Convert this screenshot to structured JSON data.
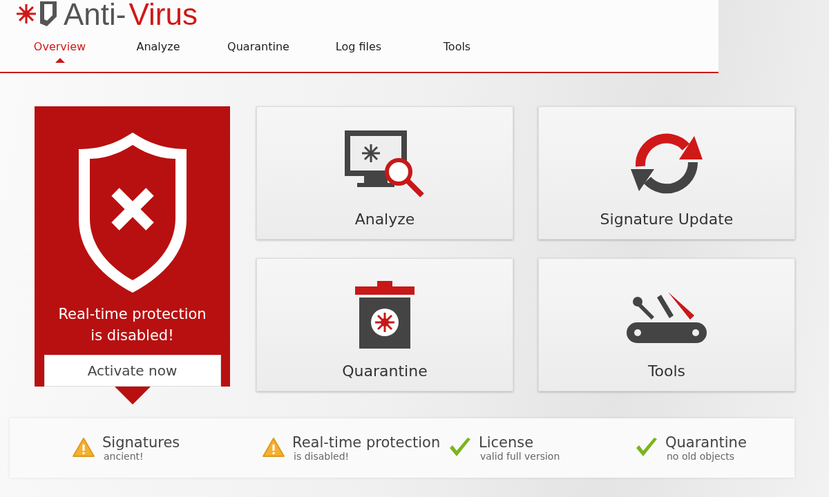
{
  "logo": {
    "prefix": "Anti-",
    "suffix": "Virus"
  },
  "tabs": [
    {
      "label": "Overview",
      "selected": true
    },
    {
      "label": "Analyze",
      "selected": false
    },
    {
      "label": "Quarantine",
      "selected": false
    },
    {
      "label": "Log files",
      "selected": false
    },
    {
      "label": "Tools",
      "selected": false
    }
  ],
  "alert": {
    "message_line1": "Real-time protection",
    "message_line2": "is disabled!",
    "button": "Activate now"
  },
  "tiles": [
    {
      "kind": "analyze",
      "label": "Analyze"
    },
    {
      "kind": "update",
      "label": "Signature Update"
    },
    {
      "kind": "quarantine",
      "label": "Quarantine"
    },
    {
      "kind": "tools",
      "label": "Tools"
    }
  ],
  "status": [
    {
      "kind": "warning",
      "title": "Signatures",
      "detail": "ancient!"
    },
    {
      "kind": "warning",
      "title": "Real-time protection",
      "detail": "is disabled!"
    },
    {
      "kind": "ok",
      "title": "License",
      "detail": "valid full version"
    },
    {
      "kind": "ok",
      "title": "Quarantine",
      "detail": "no old objects"
    }
  ]
}
